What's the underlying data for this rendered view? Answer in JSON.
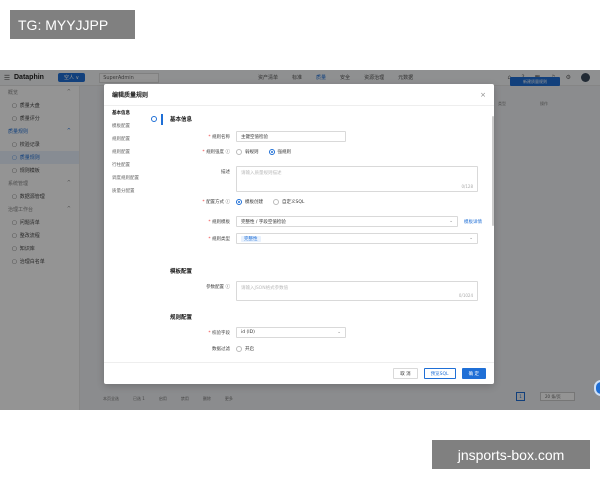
{
  "overlay": {
    "label": "TG: MYYJJPP",
    "watermark": "jnsports-box.com"
  },
  "app": {
    "logo": "Dataphin",
    "project": "空人 ∨",
    "workspace": "SuperAdmin",
    "nav": [
      "资产清单",
      "标准",
      "质量",
      "安全",
      "资源治理",
      "元数据"
    ],
    "active_nav": "质量"
  },
  "sidebar": [
    {
      "type": "group",
      "label": "概览",
      "icon": "^"
    },
    {
      "type": "item",
      "label": "质量大盘"
    },
    {
      "type": "item",
      "label": "质量评分"
    },
    {
      "type": "group",
      "label": "质量规则",
      "icon": "^",
      "blue": true
    },
    {
      "type": "item",
      "label": "校验记录"
    },
    {
      "type": "item",
      "label": "质量规则",
      "active": true
    },
    {
      "type": "item",
      "label": "规则模板"
    },
    {
      "type": "group",
      "label": "系统管理",
      "icon": "^"
    },
    {
      "type": "item",
      "label": "数据源管理"
    },
    {
      "type": "group",
      "label": "治理工作台",
      "icon": "^"
    },
    {
      "type": "item",
      "label": "问题清单"
    },
    {
      "type": "item",
      "label": "整改流程"
    },
    {
      "type": "item",
      "label": "知识库"
    },
    {
      "type": "item",
      "label": "治理白名单"
    }
  ],
  "background": {
    "new_rule_button": "新建质量规则",
    "col_type": "类型",
    "col_ops": "操作",
    "bottom": [
      "本页全选",
      "已选 1",
      "启用",
      "禁用",
      "删除",
      "更多"
    ],
    "page": "1",
    "per_page": "20 条/页"
  },
  "modal": {
    "title": "编辑质量规则",
    "nav": [
      "基本信息",
      "模板配置",
      "规则配置",
      "规则配置",
      "行柱配置",
      "调度规则配置",
      "质量分配置"
    ],
    "basic_section": "基本信息",
    "fields": {
      "rule_name_label": "规则名称",
      "rule_name_value": "主键空值检验",
      "strength_label": "规则强度",
      "strength_weak": "弱规则",
      "strength_strong": "强规则",
      "desc_label": "描述",
      "desc_placeholder": "请输入质量规则描述",
      "desc_count": "0/128",
      "config_mode_label": "配置方式",
      "config_template": "模板创建",
      "config_sql": "自定义SQL",
      "template_label": "规则模板",
      "template_value": "完整性 / 字段空值检验",
      "template_link": "模板详情",
      "rule_type_label": "规则类型",
      "rule_type_tag": "完整性"
    },
    "template_section": "模板配置",
    "param_label": "参数配置",
    "param_placeholder": "请输入JSON格式参数值",
    "param_count": "0/1024",
    "rule_section": "规则配置",
    "field_label": "校验字段",
    "field_value": "id (ID)",
    "filter_label": "数据过滤",
    "filter_value": "开启",
    "buttons": {
      "cancel": "取 消",
      "preview": "预览SQL",
      "ok": "确 定"
    }
  }
}
